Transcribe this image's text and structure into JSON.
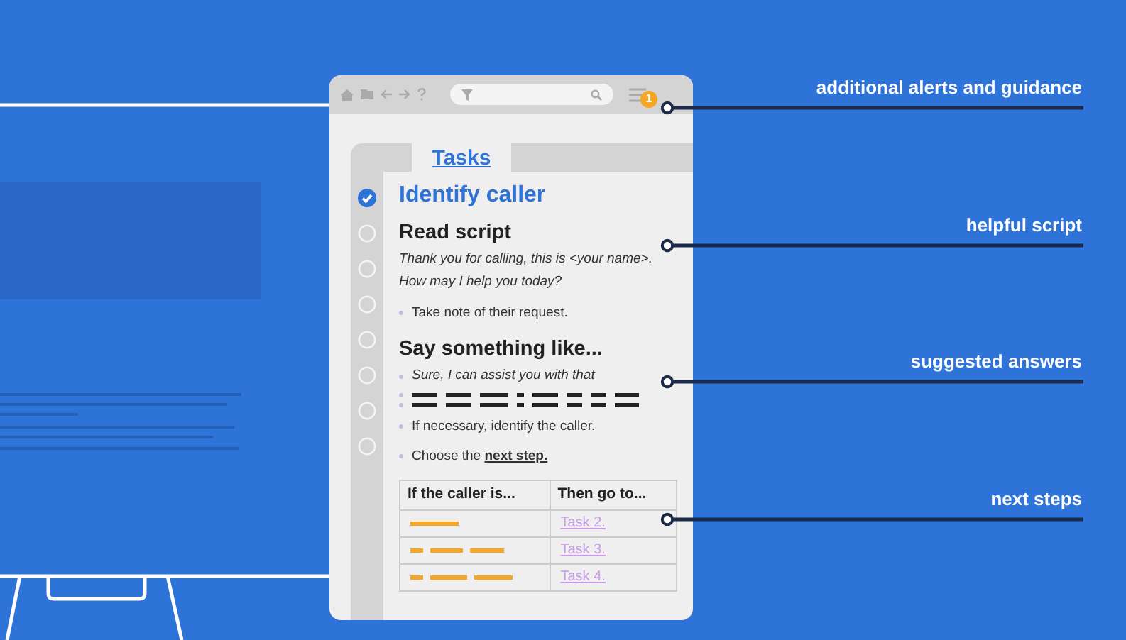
{
  "panel": {
    "notification_count": "1",
    "tab": {
      "label": "Tasks",
      "selected": true
    },
    "steps": [
      {
        "checked": true
      },
      {
        "checked": false
      },
      {
        "checked": false
      },
      {
        "checked": false
      },
      {
        "checked": false
      },
      {
        "checked": false
      },
      {
        "checked": false
      },
      {
        "checked": false
      }
    ],
    "content": [
      {
        "kind": "heading-done",
        "text": "Identify caller"
      },
      {
        "kind": "heading",
        "text": "Read script"
      },
      {
        "kind": "script",
        "text": "Thank you for calling, this is <your name>. How may I help you today?"
      },
      {
        "kind": "bullet",
        "text": "Take note of their request."
      },
      {
        "kind": "heading",
        "text": "Say something like..."
      },
      {
        "kind": "bullet-italic",
        "text": "Sure, I can assist you with that"
      },
      {
        "kind": "dashes"
      },
      {
        "kind": "dashes"
      },
      {
        "kind": "bullet",
        "text": "If necessary, identify the caller."
      },
      {
        "kind": "bullet",
        "text": "Choose the **next step.**"
      }
    ],
    "table": {
      "columns": [
        "If the caller is...",
        "Then go to..."
      ],
      "rows": [
        {
          "link": "Task 2."
        },
        {
          "link": "Task 3."
        },
        {
          "link": "Task 4."
        }
      ]
    }
  },
  "callouts": [
    {
      "text": "additional alerts and guidance"
    },
    {
      "text": "helpful script"
    },
    {
      "text": "suggested answers"
    },
    {
      "text": "next steps"
    }
  ]
}
